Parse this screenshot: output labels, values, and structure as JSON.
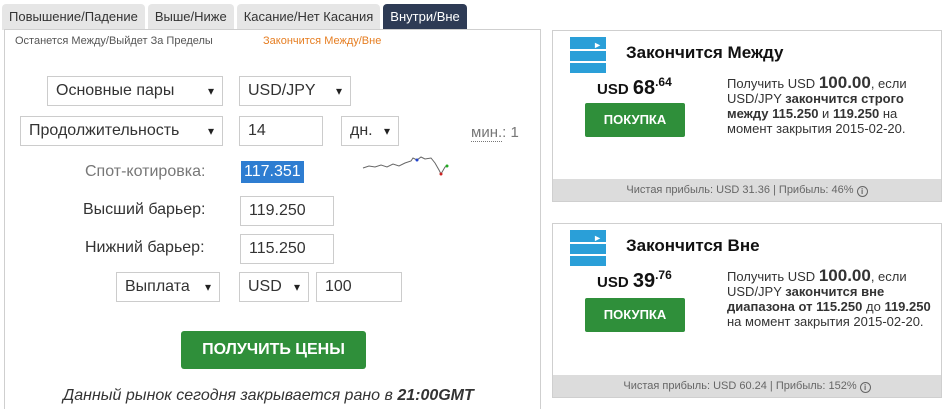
{
  "tabs": [
    {
      "label": "Повышение/Падение",
      "active": false
    },
    {
      "label": "Выше/Ниже",
      "active": false
    },
    {
      "label": "Касание/Нет Касания",
      "active": false
    },
    {
      "label": "Внутри/Вне",
      "active": true
    }
  ],
  "subtabs": [
    {
      "label": "Останется Между/Выйдет За Пределы",
      "active": false
    },
    {
      "label": "Закончится Между/Вне",
      "active": true
    }
  ],
  "form": {
    "market": "Основные пары",
    "symbol": "USD/JPY",
    "duration_type": "Продолжительность",
    "duration_value": "14",
    "duration_unit": "дн.",
    "min_label": "мин.",
    "min_value": ": 1",
    "spot_label": "Спот-котировка:",
    "spot_value": "117.351",
    "high_barrier_label": "Высший барьер:",
    "high_barrier_value": "119.250",
    "low_barrier_label": "Нижний барьер:",
    "low_barrier_value": "115.250",
    "payout_type": "Выплата",
    "currency": "USD",
    "amount": "100",
    "get_prices_label": "ПОЛУЧИТЬ ЦЕНЫ",
    "market_note_prefix": "Данный рынок сегодня закрывается рано в",
    "market_note_time": "21:00GMT"
  },
  "cards": [
    {
      "title": "Закончится Между",
      "currency": "USD",
      "price_int": "68",
      "price_dec": ".64",
      "buy_label": "ПОКУПКА",
      "desc_prefix": "Получить USD",
      "desc_amount": "100.00",
      "desc_if": ", если",
      "desc_symbol": "USD/JPY",
      "desc_bold": "закончится строго между 115.250",
      "desc_and": "и",
      "desc_bold2": "119.250",
      "desc_suffix": "на момент закрытия 2015-02-20.",
      "footer": "Чистая прибыль: USD 31.36 | Прибыль: 46%"
    },
    {
      "title": "Закончится Вне",
      "currency": "USD",
      "price_int": "39",
      "price_dec": ".76",
      "buy_label": "ПОКУПКА",
      "desc_prefix": "Получить USD",
      "desc_amount": "100.00",
      "desc_if": ", если",
      "desc_symbol": "USD/JPY",
      "desc_bold": "закончится вне диапазона от 115.250",
      "desc_and": "до",
      "desc_bold2": "119.250",
      "desc_suffix": "на момент закрытия 2015-02-20.",
      "footer": "Чистая прибыль: USD 60.24 | Прибыль: 152%"
    }
  ],
  "colors": {
    "active_tab": "#2e3b55",
    "accent_orange": "#e67e22",
    "buy_green": "#2f8f3a",
    "icon_blue": "#2a9fd8",
    "spot_highlight": "#2e7dd1"
  },
  "icons": {
    "card_icon": "range-icon",
    "info": "info-icon"
  }
}
